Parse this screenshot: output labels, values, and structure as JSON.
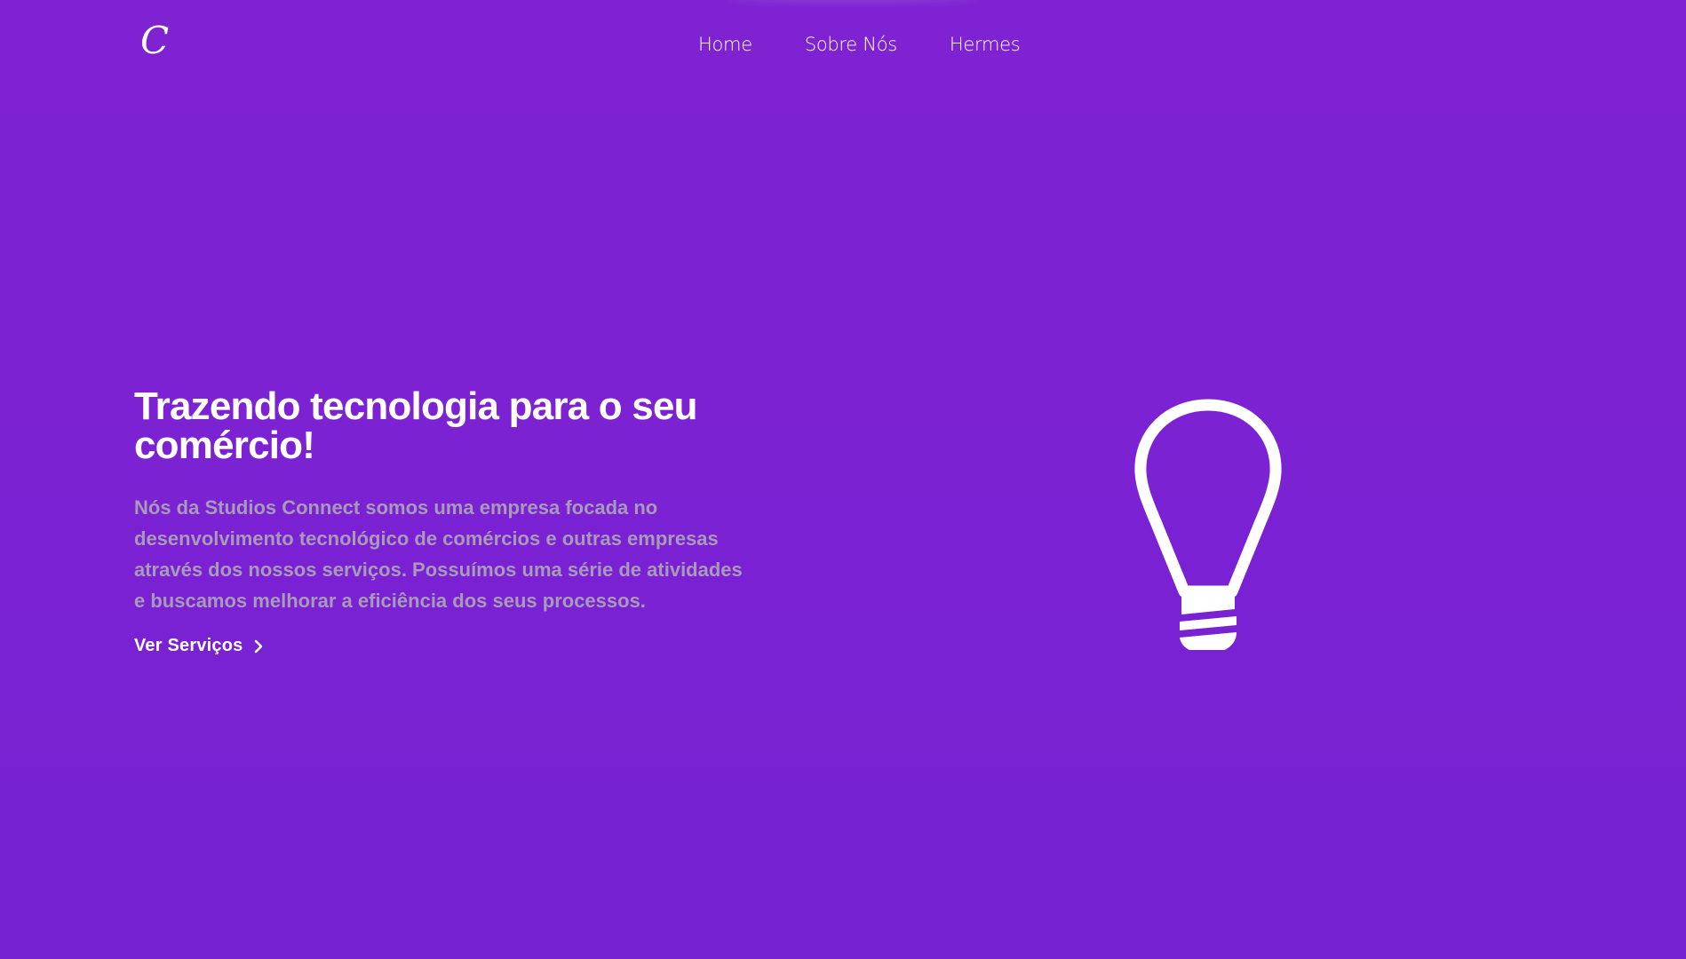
{
  "brand": {
    "logo_text": "C"
  },
  "nav": {
    "items": [
      {
        "label": "Home"
      },
      {
        "label": "Sobre Nós"
      },
      {
        "label": "Hermes"
      }
    ]
  },
  "hero": {
    "title": "Trazendo tecnologia para o seu comércio!",
    "description": "Nós da Studios Connect somos uma empresa focada no desenvolvimento tecnológico de comércios e outras empresas através dos nossos serviços. Possuímos uma série de atividades e buscamos melhorar a eficiência dos seus processos.",
    "cta_label": "Ver Serviços",
    "cta_icon": "chevron-right-icon",
    "illustration_icon": "lightbulb-icon"
  },
  "colors": {
    "background_top": "#7e22d2",
    "background_bottom": "#7522d2",
    "text_primary": "#ffffff",
    "text_muted": "#a99ab8"
  }
}
